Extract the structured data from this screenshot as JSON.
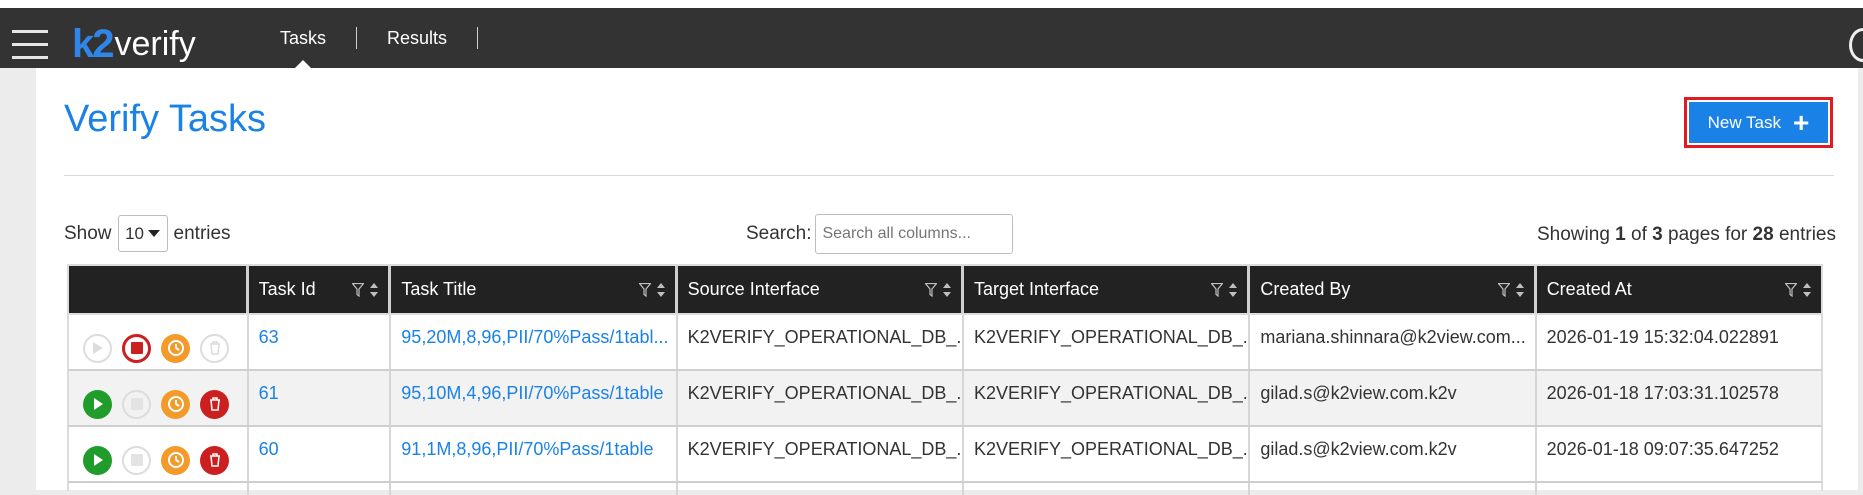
{
  "header": {
    "logo_k2": "k2",
    "logo_verify": "verify",
    "nav": [
      {
        "label": "Tasks",
        "active": true
      },
      {
        "label": "Results",
        "active": false
      }
    ]
  },
  "page": {
    "title": "Verify Tasks",
    "new_task_label": "New Task"
  },
  "controls": {
    "show_label": "Show",
    "entries_value": "10",
    "entries_label": "entries",
    "search_label": "Search:",
    "search_placeholder": "Search all columns...",
    "showing_prefix": "Showing",
    "current_page": "1",
    "of_label": "of",
    "total_pages": "3",
    "pages_for_label": "pages for",
    "total_entries": "28",
    "entries_suffix": "entries"
  },
  "table": {
    "columns": [
      "",
      "Task Id",
      "Task Title",
      "Source Interface",
      "Target Interface",
      "Created By",
      "Created At"
    ],
    "rows": [
      {
        "task_id": "63",
        "task_title": "95,20M,8,96,PII/70%Pass/1tabl...",
        "source": "K2VERIFY_OPERATIONAL_DB_...",
        "target": "K2VERIFY_OPERATIONAL_DB_...",
        "created_by": "mariana.shinnara@k2view.com...",
        "created_at": "2026-01-19 15:32:04.022891",
        "running": true
      },
      {
        "task_id": "61",
        "task_title": "95,10M,4,96,PII/70%Pass/1table",
        "source": "K2VERIFY_OPERATIONAL_DB_...",
        "target": "K2VERIFY_OPERATIONAL_DB_...",
        "created_by": "gilad.s@k2view.com.k2v",
        "created_at": "2026-01-18 17:03:31.102578",
        "running": false
      },
      {
        "task_id": "60",
        "task_title": "91,1M,8,96,PII/70%Pass/1table",
        "source": "K2VERIFY_OPERATIONAL_DB_...",
        "target": "K2VERIFY_OPERATIONAL_DB_...",
        "created_by": "gilad.s@k2view.com.k2v",
        "created_at": "2026-01-18 09:07:35.647252",
        "running": false
      }
    ]
  },
  "colors": {
    "accent": "#1a82e6",
    "header_bg": "#333333",
    "play_green": "#1f9c2a",
    "stop_red": "#cc1f1f",
    "history_orange": "#f39a2b",
    "disabled": "#d9d9d9"
  }
}
